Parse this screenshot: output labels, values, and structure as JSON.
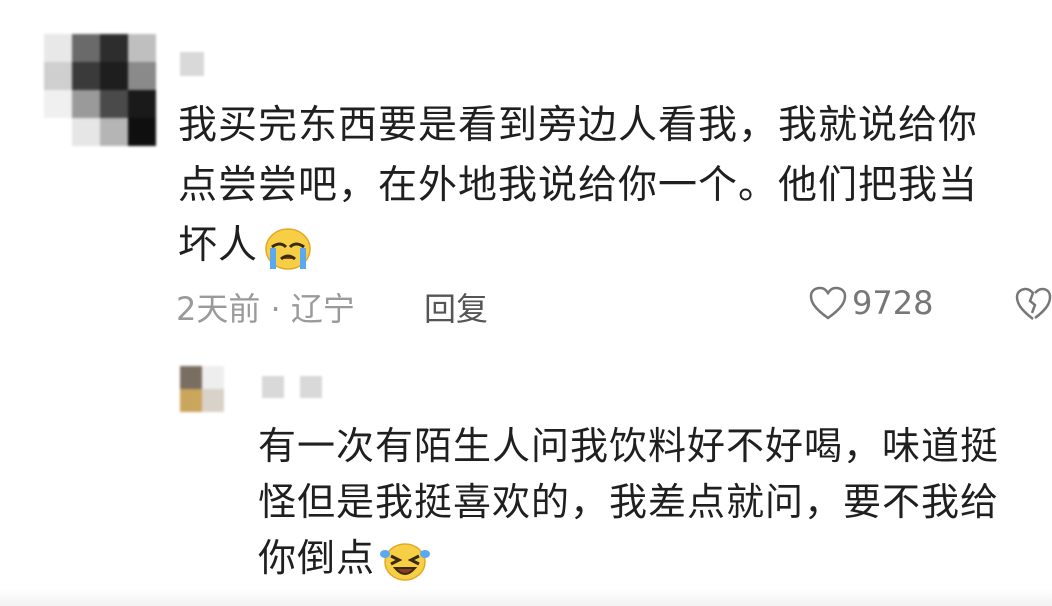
{
  "comments": [
    {
      "text_lines": [
        "我买完东西要是看到旁边人看我，我就说给你",
        "点尝尝吧，在外地我说给你一个。他们把我当",
        "坏人"
      ],
      "emoji": "crying-face-icon",
      "meta": "2天前 · 辽宁",
      "reply_label": "回复",
      "likes": "9728",
      "avatar_colors": [
        "#e8e8e8",
        "#6a6a6a",
        "#2d2d2d",
        "#bfbfbf",
        "#cfcfcf",
        "#3a3a3a",
        "#1e1e1e",
        "#8a8a8a",
        "#f0f0f0",
        "#9a9a9a",
        "#4a4a4a",
        "#1a1a1a",
        "#ffffff",
        "#e6e6e6",
        "#b5b5b5",
        "#0f0f0f"
      ]
    },
    {
      "text_lines": [
        "有一次有陌生人问我饮料好不好喝，味道挺",
        "怪但是我挺喜欢的，我差点就问，要不我给",
        "你倒点"
      ],
      "emoji": "laughing-crying-face-icon",
      "avatar_colors": [
        "#7a6e62",
        "#eeeeee",
        "#caa55c",
        "#d8d2c8"
      ]
    }
  ]
}
